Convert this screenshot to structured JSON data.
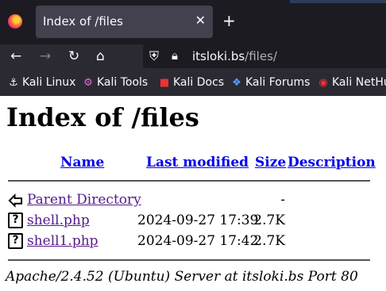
{
  "browser": {
    "tab": {
      "title": "Index of /files",
      "close": "✕"
    },
    "new_tab": "+",
    "url": {
      "host": "itsloki.bs",
      "path": "/files/"
    },
    "bookmarks": [
      {
        "label": "Kali Linux",
        "icon": "kali-linux-icon"
      },
      {
        "label": "Kali Tools",
        "icon": "kali-tools-icon"
      },
      {
        "label": "Kali Docs",
        "icon": "kali-docs-icon"
      },
      {
        "label": "Kali Forums",
        "icon": "kali-forums-icon"
      },
      {
        "label": "Kali NetHu",
        "icon": "kali-nethunter-icon"
      }
    ]
  },
  "page": {
    "title": "Index of /files",
    "columns": {
      "name": "Name",
      "last_modified": "Last modified",
      "size": "Size",
      "description": "Description"
    },
    "rows": [
      {
        "name": "Parent Directory",
        "date": "",
        "size": "-",
        "icon": "back-arrow-icon"
      },
      {
        "name": "shell.php",
        "date": "2024-09-27 17:39",
        "size": "2.7K",
        "icon": "unknown-file-icon"
      },
      {
        "name": "shell1.php",
        "date": "2024-09-27 17:42",
        "size": "2.7K",
        "icon": "unknown-file-icon"
      }
    ],
    "address": "Apache/2.4.52 (Ubuntu) Server at itsloki.bs Port 80"
  }
}
